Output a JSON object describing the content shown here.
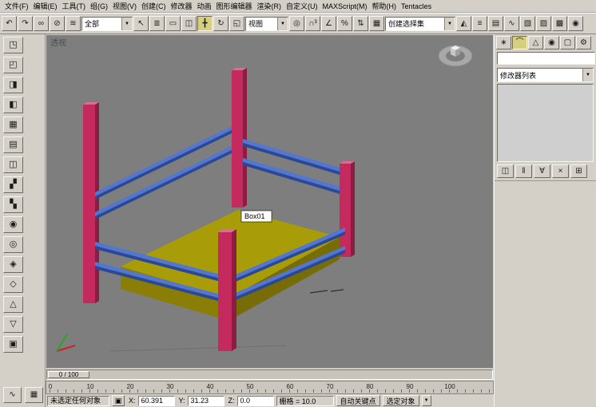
{
  "menu_bar": {
    "items": [
      {
        "name": "menu-file",
        "label": "文件(F)"
      },
      {
        "name": "menu-edit",
        "label": "编辑(E)"
      },
      {
        "name": "menu-tools",
        "label": "工具(T)"
      },
      {
        "name": "menu-group",
        "label": "组(G)"
      },
      {
        "name": "menu-views",
        "label": "视图(V)"
      },
      {
        "name": "menu-create",
        "label": "创建(C)"
      },
      {
        "name": "menu-modifiers",
        "label": "修改器"
      },
      {
        "name": "menu-animation",
        "label": "动画"
      },
      {
        "name": "menu-graph-editors",
        "label": "图形编辑器"
      },
      {
        "name": "menu-rendering",
        "label": "渲染(R)"
      },
      {
        "name": "menu-customize",
        "label": "自定义(U)"
      },
      {
        "name": "menu-maxscript",
        "label": "MAXScript(M)"
      },
      {
        "name": "menu-help",
        "label": "帮助(H)"
      },
      {
        "name": "menu-tentacles",
        "label": "Tentacles"
      }
    ]
  },
  "toolbar": {
    "group1": [
      {
        "name": "undo-icon",
        "glyph": "↶"
      },
      {
        "name": "redo-icon",
        "glyph": "↷"
      }
    ],
    "group2": [
      {
        "name": "select-and-link-icon",
        "glyph": "∞"
      },
      {
        "name": "unlink-selection-icon",
        "glyph": "⊘"
      },
      {
        "name": "bind-to-space-warp-icon",
        "glyph": "≋"
      }
    ],
    "selection_filter_value": "全部",
    "group3": [
      {
        "name": "select-object-icon",
        "glyph": "↖"
      },
      {
        "name": "select-by-name-icon",
        "glyph": "≣"
      },
      {
        "name": "rectangular-selection-region-icon",
        "glyph": "▭"
      },
      {
        "name": "window-crossing-toggle-icon",
        "glyph": "◫"
      }
    ],
    "group4": [
      {
        "name": "select-and-move-icon",
        "glyph": "╋",
        "pressed": true
      },
      {
        "name": "select-and-rotate-icon",
        "glyph": "↻"
      },
      {
        "name": "select-and-uniform-scale-icon",
        "glyph": "◱"
      }
    ],
    "coordsys_value": "视图",
    "group5": [
      {
        "name": "use-pivot-point-center-icon",
        "glyph": "◎"
      }
    ],
    "group6": [
      {
        "name": "snap-toggle-3d-icon",
        "glyph": "∩³"
      },
      {
        "name": "angle-snap-toggle-icon",
        "glyph": "∠"
      },
      {
        "name": "percent-snap-toggle-icon",
        "glyph": "%"
      },
      {
        "name": "spinner-snap-toggle-icon",
        "glyph": "⇅"
      }
    ],
    "group7": [
      {
        "name": "edit-named-selection-sets-icon",
        "glyph": "▦"
      }
    ],
    "named_selection_value": "创建选择集",
    "group8": [
      {
        "name": "mirror-icon",
        "glyph": "◭"
      },
      {
        "name": "align-icon",
        "glyph": "≡"
      },
      {
        "name": "layer-manager-icon",
        "glyph": "▤"
      },
      {
        "name": "curve-editor-icon",
        "glyph": "∿"
      },
      {
        "name": "schematic-view-icon",
        "glyph": "▧"
      },
      {
        "name": "material-editor-icon",
        "glyph": "▨"
      },
      {
        "name": "render-setup-icon",
        "glyph": "▩"
      },
      {
        "name": "quick-render-icon",
        "glyph": "◉"
      }
    ]
  },
  "left_toolbar": {
    "icons": [
      {
        "name": "left-tool-icon-01",
        "glyph": "◳"
      },
      {
        "name": "left-tool-icon-02",
        "glyph": "◰"
      },
      {
        "name": "left-tool-icon-03",
        "glyph": "◨"
      },
      {
        "name": "left-tool-icon-04",
        "glyph": "◧"
      },
      {
        "name": "left-tool-icon-05",
        "glyph": "▦"
      },
      {
        "name": "left-tool-icon-06",
        "glyph": "▤"
      },
      {
        "name": "left-tool-icon-07",
        "glyph": "◫"
      },
      {
        "name": "left-tool-icon-08",
        "glyph": "▞"
      },
      {
        "name": "left-tool-icon-09",
        "glyph": "▚"
      },
      {
        "name": "left-tool-icon-10",
        "glyph": "◉"
      },
      {
        "name": "left-tool-icon-11",
        "glyph": "◎"
      },
      {
        "name": "left-tool-icon-12",
        "glyph": "◈"
      },
      {
        "name": "left-tool-icon-13",
        "glyph": "◇"
      },
      {
        "name": "left-tool-icon-14",
        "glyph": "△"
      },
      {
        "name": "left-tool-icon-15",
        "glyph": "▽"
      },
      {
        "name": "left-tool-icon-16",
        "glyph": "▣"
      }
    ],
    "corner_icons": [
      {
        "name": "mini-curve-editor-button",
        "glyph": "∿"
      },
      {
        "name": "time-tag-button",
        "glyph": "▦"
      }
    ]
  },
  "viewport": {
    "view_label": "透视",
    "object_label": "Box01",
    "colors": {
      "background": "#7e7e7e",
      "border": "#e8e400",
      "box_top": "#a89c08",
      "box_left": "#8a7e06",
      "box_right": "#776c05",
      "post_front": "#c42a5e",
      "post_side": "#8c1c42",
      "post_top": "#d96d93",
      "rail_light": "#5377d0",
      "rail_dark": "#2a4898"
    }
  },
  "command_panel": {
    "tabs": [
      {
        "name": "tab-create",
        "glyph": "∗"
      },
      {
        "name": "tab-modify",
        "glyph": "⌒",
        "active": true
      },
      {
        "name": "tab-hierarchy",
        "glyph": "△"
      },
      {
        "name": "tab-motion",
        "glyph": "◉"
      },
      {
        "name": "tab-display",
        "glyph": "▢"
      },
      {
        "name": "tab-utilities",
        "glyph": "⚙"
      }
    ],
    "name_field_value": "",
    "modifier_list_label": "修改器列表",
    "stack_buttons": [
      {
        "name": "pin-stack-button",
        "glyph": "◫"
      },
      {
        "name": "show-end-result-button",
        "glyph": "‖"
      },
      {
        "name": "make-unique-button",
        "glyph": "∀"
      },
      {
        "name": "remove-modifier-button",
        "glyph": "×"
      },
      {
        "name": "configure-modifier-sets-button",
        "glyph": "⊞"
      }
    ]
  },
  "timeline": {
    "slider_label": "0 / 100"
  },
  "ruler": {
    "ticks": [
      "0",
      "10",
      "20",
      "30",
      "40",
      "50",
      "60",
      "70",
      "80",
      "90",
      "100"
    ]
  },
  "status_bar": {
    "prompt": "未选定任何对象",
    "lock_glyph": "▣",
    "x_label": "X:",
    "x_value": "60.391",
    "y_label": "Y:",
    "y_value": "31.23",
    "z_label": "Z:",
    "z_value": "0.0",
    "grid_text": "栅格 = 10.0",
    "auto_key_label": "自动关键点",
    "selected_label": "选定对象"
  }
}
